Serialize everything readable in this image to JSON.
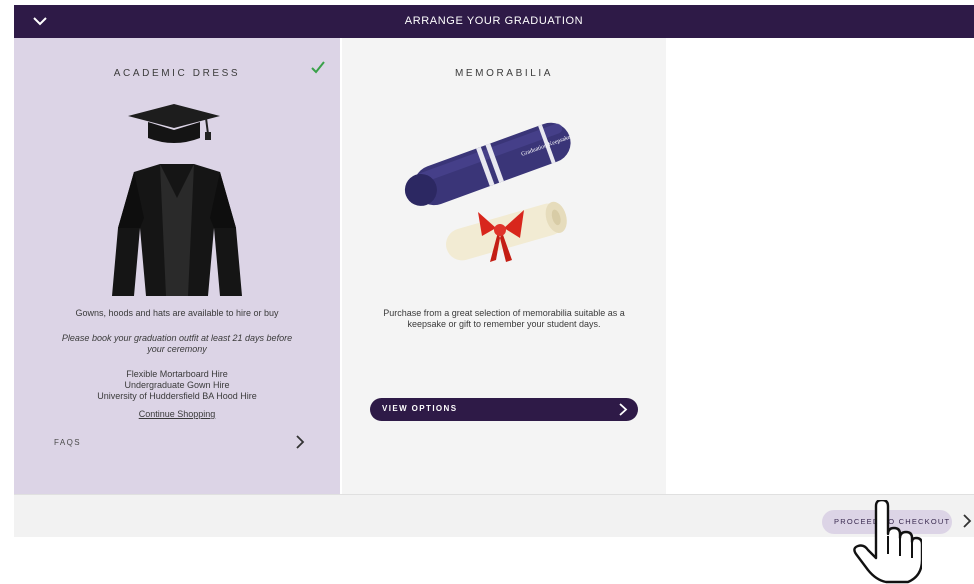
{
  "header": {
    "title": "ARRANGE YOUR GRADUATION",
    "icon": "chevron-down-icon"
  },
  "panels": {
    "academic": {
      "title": "ACADEMIC DRESS",
      "status_icon": "checkmark-icon",
      "status_color": "#3aa14a",
      "description": "Gowns, hoods and hats are available to hire or buy",
      "notice": "Please book your graduation outfit at least 21 days before your ceremony",
      "items": [
        "Flexible Mortarboard Hire",
        "Undergraduate Gown Hire",
        "University of Huddersfield BA Hood Hire"
      ],
      "continue_link": "Continue Shopping",
      "faqs_label": "FAQS"
    },
    "memorabilia": {
      "title": "MEMORABILIA",
      "tube_label": "Graduation Keepsake",
      "description": "Purchase from a great selection of memorabilia suitable as a keepsake or gift to remember your student days.",
      "button_label": "VIEW OPTIONS"
    }
  },
  "footer": {
    "checkout_label": "PROCEED TO CHECKOUT"
  },
  "colors": {
    "brand_dark": "#2e1a47",
    "panel_lilac": "#dcd4e6",
    "panel_grey": "#f4f4f4"
  }
}
